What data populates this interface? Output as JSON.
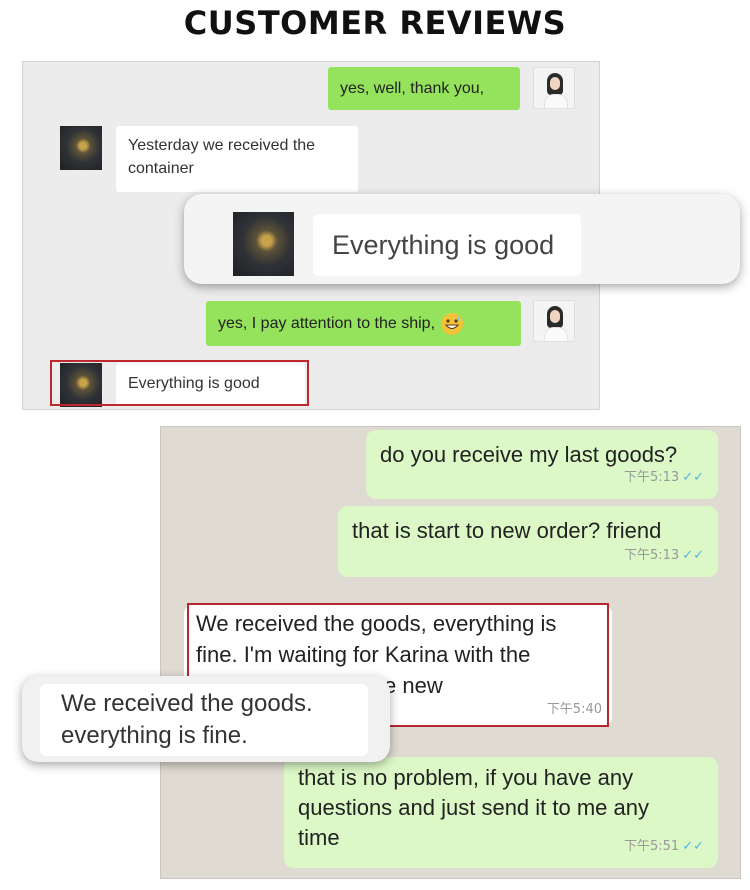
{
  "title": "CUSTOMER REVIEWS",
  "chat1": {
    "messages": [
      {
        "side": "right",
        "text": "yes, well, thank you,"
      },
      {
        "side": "left",
        "line1": "Yesterday we received the",
        "line2": "container"
      },
      {
        "side": "right",
        "text": "yes, I pay attention to the ship,",
        "emoji": "grinning-face-with-sweat"
      },
      {
        "side": "left",
        "text": "Everything is good",
        "highlighted": true
      }
    ],
    "callout": {
      "text": "Everything is good"
    }
  },
  "chat2": {
    "messages": [
      {
        "side": "right",
        "text": "do you receive my last goods?",
        "time": "下午5:13"
      },
      {
        "side": "right",
        "text": "that is start to new order? friend",
        "time": "下午5:13"
      },
      {
        "side": "left",
        "line1": "We received the goods, everything is",
        "line2": "fine. I'm waiting for Karina with the",
        "line3": "e new",
        "time": "下午5:40",
        "highlighted": true
      },
      {
        "side": "right",
        "line1": "that is no problem, if you have any",
        "line2": "questions and just send it to me any",
        "line3": "time",
        "time": "下午5:51"
      }
    ],
    "callout": {
      "line1": "We received the goods.",
      "line2": "everything is fine."
    }
  },
  "colors": {
    "wechat_green": "#95e35c",
    "whatsapp_green": "#dcf8c6",
    "highlight_red": "#c0272d",
    "read_ticks": "#4fb6ec"
  }
}
